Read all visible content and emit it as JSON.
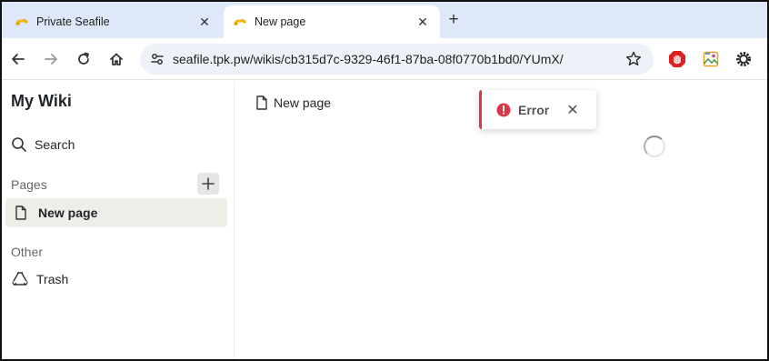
{
  "browser": {
    "tabs": [
      {
        "title": "Private Seafile",
        "active": false
      },
      {
        "title": "New page",
        "active": true
      }
    ],
    "close_glyph": "✕",
    "new_tab_glyph": "+",
    "url": "seafile.tpk.pw/wikis/cb315d7c-9329-46f1-87ba-08f0770b1bd0/YUmX/"
  },
  "sidebar": {
    "title": "My Wiki",
    "search_label": "Search",
    "pages_section": "Pages",
    "pages": [
      {
        "label": "New page"
      }
    ],
    "other_section": "Other",
    "trash_label": "Trash"
  },
  "main": {
    "breadcrumb_title": "New page"
  },
  "toast": {
    "message": "Error",
    "close_glyph": "✕"
  },
  "colors": {
    "tabstrip_bg": "#dfe8f8",
    "error_red": "#dc3545",
    "selected_page_bg": "#eeede7",
    "seafile_yellow": "#f5b400"
  }
}
